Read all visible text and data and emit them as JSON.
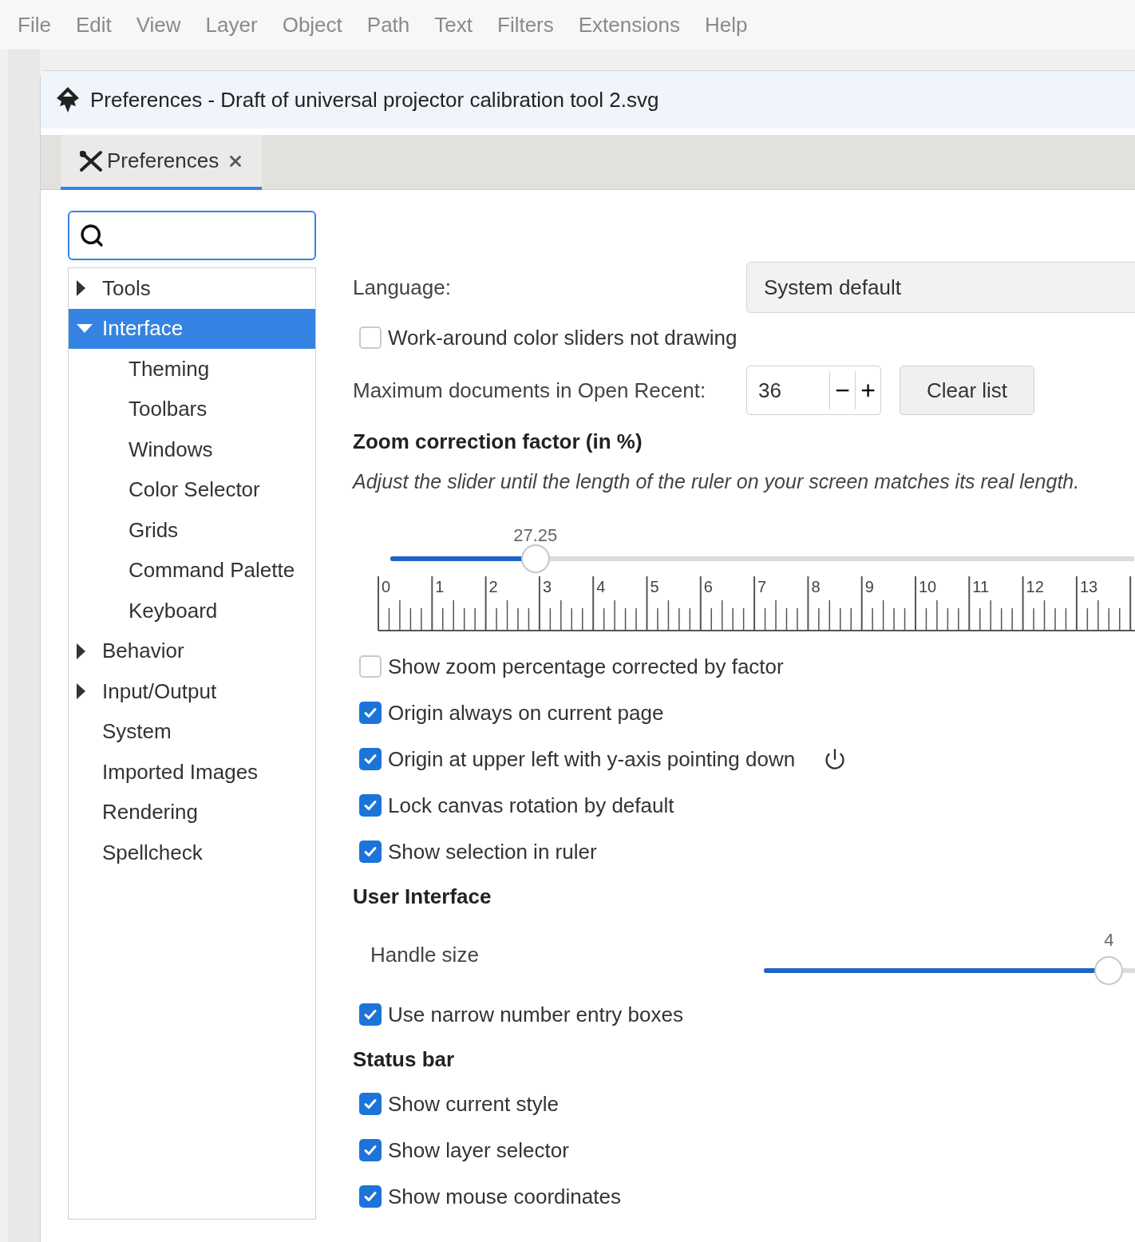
{
  "menu": [
    "File",
    "Edit",
    "View",
    "Layer",
    "Object",
    "Path",
    "Text",
    "Filters",
    "Extensions",
    "Help"
  ],
  "window": {
    "title": "Preferences - Draft of universal projector calibration tool 2.svg"
  },
  "tabs": [
    {
      "label": "Preferences",
      "selected": true
    }
  ],
  "tree": [
    {
      "label": "Tools",
      "kind": "branch",
      "expanded": false,
      "selected": false
    },
    {
      "label": "Interface",
      "kind": "branch",
      "expanded": true,
      "selected": true,
      "children": [
        {
          "label": "Theming",
          "kind": "leaf",
          "selected": false
        },
        {
          "label": "Toolbars",
          "kind": "leaf",
          "selected": false
        },
        {
          "label": "Windows",
          "kind": "leaf",
          "selected": false
        },
        {
          "label": "Color Selector",
          "kind": "leaf",
          "selected": false
        },
        {
          "label": "Grids",
          "kind": "leaf",
          "selected": false
        },
        {
          "label": "Command Palette",
          "kind": "leaf",
          "selected": false
        },
        {
          "label": "Keyboard",
          "kind": "leaf",
          "selected": false
        }
      ]
    },
    {
      "label": "Behavior",
      "kind": "branch",
      "expanded": false,
      "selected": false
    },
    {
      "label": "Input/Output",
      "kind": "branch",
      "expanded": false,
      "selected": false
    },
    {
      "label": "System",
      "kind": "leaf",
      "selected": false
    },
    {
      "label": "Imported Images",
      "kind": "leaf",
      "selected": false
    },
    {
      "label": "Rendering",
      "kind": "leaf",
      "selected": false
    },
    {
      "label": "Spellcheck",
      "kind": "leaf",
      "selected": false
    }
  ],
  "settings": [
    {
      "kind": "dropdown",
      "label": "Language:",
      "value": "System default"
    },
    {
      "kind": "checkbox",
      "label": "Work-around color sliders not drawing",
      "checked": false
    },
    {
      "kind": "spin",
      "label": "Maximum documents in Open Recent:",
      "value": "36",
      "minus": "−",
      "plus": "+",
      "button": "Clear list"
    },
    {
      "kind": "heading",
      "label": "Zoom correction factor (in %)"
    },
    {
      "kind": "note",
      "label": "Adjust the slider until the length of the ruler on your screen matches its real length."
    },
    {
      "kind": "zoom_slider",
      "reading": "27.25",
      "level": 0.195,
      "ruler": [
        "0",
        "1",
        "2",
        "3",
        "4",
        "5",
        "6",
        "7",
        "8",
        "9",
        "10",
        "11",
        "12",
        "13"
      ]
    },
    {
      "kind": "checkbox",
      "label": "Show zoom percentage corrected by factor",
      "checked": false
    },
    {
      "kind": "checkbox",
      "label": "Origin always on current page",
      "checked": true
    },
    {
      "kind": "checkbox",
      "label": "Origin at upper left with y-axis pointing down",
      "checked": true,
      "reset": true
    },
    {
      "kind": "checkbox",
      "label": "Lock canvas rotation by default",
      "checked": true
    },
    {
      "kind": "checkbox",
      "label": "Show selection in ruler",
      "checked": true
    },
    {
      "kind": "heading",
      "label": "User Interface"
    },
    {
      "kind": "slider",
      "label": "Handle size",
      "reading": "4",
      "level": 0.93
    },
    {
      "kind": "checkbox",
      "label": "Use narrow number entry boxes",
      "checked": true
    },
    {
      "kind": "heading",
      "label": "Status bar"
    },
    {
      "kind": "checkbox",
      "label": "Show current style",
      "checked": true
    },
    {
      "kind": "checkbox",
      "label": "Show layer selector",
      "checked": true
    },
    {
      "kind": "checkbox",
      "label": "Show mouse coordinates",
      "checked": true
    }
  ]
}
